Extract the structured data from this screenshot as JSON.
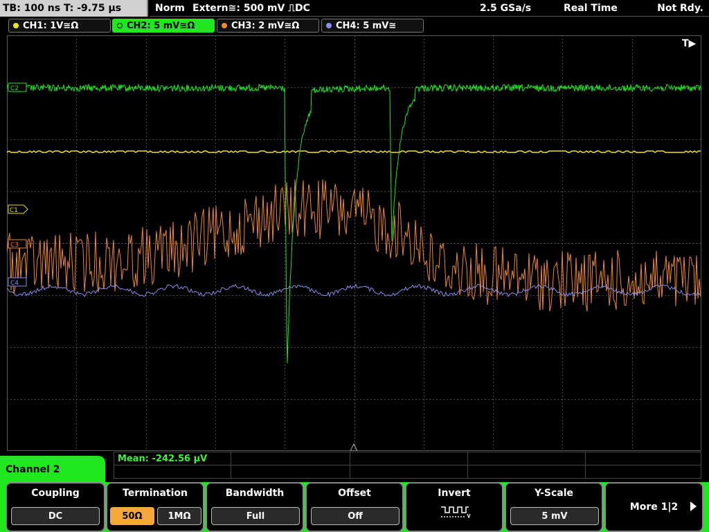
{
  "status": {
    "timebase": "TB: 100 ns   T: -9.75 µs",
    "trigger_mode": "Norm",
    "trigger": "Extern≅: 500 mV ⎍DC",
    "sample_rate": "2.5 GSa/s",
    "acquisition": "Real Time",
    "state": "Not Rdy."
  },
  "channels": [
    {
      "label": "CH1: 1V≅Ω",
      "color": "#f0e51d",
      "active": false
    },
    {
      "label": "CH2: 5 mV≅Ω",
      "color": "#1fe81f",
      "active": true
    },
    {
      "label": "CH3: 2 mV≅Ω",
      "color": "#f08a2c",
      "active": false
    },
    {
      "label": "CH4: 5 mV≅",
      "color": "#8c8cf0",
      "active": false
    }
  ],
  "markers": {
    "trigger_label": "T▶",
    "ch2": "C2",
    "ch1": "C1",
    "ch3": "C3",
    "ch4": "C4"
  },
  "measurement": {
    "label": "Mean: -242.56 µV"
  },
  "menu": {
    "title": "Channel 2",
    "softkeys": {
      "coupling": {
        "label": "Coupling",
        "value": "DC"
      },
      "termination": {
        "label": "Termination",
        "options": [
          "50Ω",
          "1MΩ"
        ],
        "selected": "50Ω"
      },
      "bandwidth": {
        "label": "Bandwidth",
        "value": "Full"
      },
      "offset": {
        "label": "Offset",
        "value": "Off"
      },
      "invert": {
        "label": "Invert",
        "icon": "square-wave-invert-icon"
      },
      "yscale": {
        "label": "Y-Scale",
        "value": "5 mV"
      },
      "more": {
        "label": "More 1|2"
      }
    }
  },
  "colors": {
    "ch1": "#f0e51d",
    "ch2": "#1fe81f",
    "ch3": "#f08a2c",
    "ch4": "#8c8cf0",
    "grid": "#4a4a4a"
  }
}
